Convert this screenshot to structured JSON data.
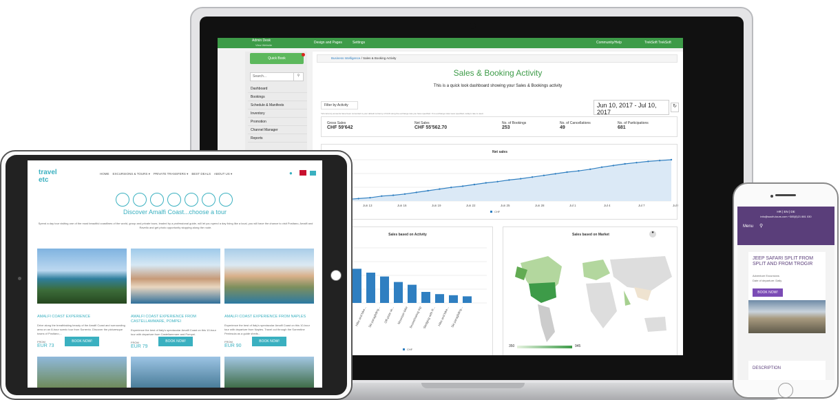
{
  "laptop": {
    "topbar": {
      "brand": "Admin Desk",
      "view_website": "View Website",
      "design": "Design and Pages",
      "settings": "Settings",
      "community": "Community/Help",
      "user": "TrekSoft TrekSoft"
    },
    "sidebar": {
      "quick_book": "Quick Book",
      "search_placeholder": "Search...",
      "items": [
        "Dashboard",
        "Bookings",
        "Schedule & Manifests",
        "Inventory",
        "Promotion",
        "Channel Manager",
        "Reports"
      ]
    },
    "breadcrumb": {
      "root": "Business Intelligence",
      "current": "Sales & Booking Activity"
    },
    "page": {
      "title": "Sales & Booking Activity",
      "subtitle": "This is a quick look dashboard showing your Sales & Bookings activity",
      "filter": "Filter by Activity",
      "note": "*All currency amounts have been converted to your default currency of CHF using the exchange rate you have specified. If no exchange rates were specified, today's rate is used.",
      "date_range": "Jun 10, 2017 - Jul 10, 2017",
      "compare_to": "Compare to"
    },
    "kpis": [
      {
        "label": "Gross Sales",
        "value": "CHF 59'642"
      },
      {
        "label": "Net Sales",
        "value": "CHF 55'562.70"
      },
      {
        "label": "No. of Bookings",
        "value": "253"
      },
      {
        "label": "No. of Cancellations",
        "value": "49"
      },
      {
        "label": "No. of Participations",
        "value": "681"
      }
    ],
    "net_sales": {
      "title": "Net sales",
      "legend": "CHF",
      "ticks": [
        "Jun 13",
        "Jun 16",
        "Jun 19",
        "Jun 22",
        "Jun 25",
        "Jun 28",
        "Jul 1",
        "Jul 4",
        "Jul 7",
        "Jul 9"
      ],
      "values": [
        2,
        4,
        6,
        8,
        12,
        14,
        17,
        21,
        25,
        29,
        33,
        36,
        40,
        44,
        47,
        51,
        54,
        58,
        62,
        66,
        70,
        73,
        77,
        82,
        86,
        90,
        93,
        96,
        98,
        100
      ]
    },
    "activity": {
      "title": "Sales based on Activity",
      "legend": "CHF",
      "labels": [
        "Sailing with R...",
        "Hike and bike...",
        "Ski paragliding...",
        "Off-piste sk...",
        "Mountain bike",
        "Snowshoeing trip",
        "Sledging with R...",
        "Hike and bike...",
        "Ski paragliding..."
      ],
      "values": [
        100,
        62,
        55,
        48,
        38,
        33,
        20,
        16,
        14,
        12
      ]
    },
    "market": {
      "title": "Sales based on Market",
      "scale_min": "350",
      "scale_max": "945"
    }
  },
  "tablet": {
    "logo": "travel etc",
    "nav": [
      "HOME",
      "EXCURSIONS & TOURS",
      "PRIVATE TRANSFERS",
      "BEST DEALS",
      "ABOUT US"
    ],
    "heading": "Discover Amalfi Coast...choose a tour",
    "intro": "Spend a day tour visiting one of the most beautiful coastlines of the world, group and private tours, leaded by a professional guide, will let you spend a day living like a local, you will have the chance to visit Positano, Amalfi and Ravello and get photo opportunity stopping along the route.",
    "tours": [
      {
        "title": "AMALFI COAST EXPERIENCE",
        "desc": "Drive along the breathtaking beauty of the Amalfi Coast and surrounding area on an 8-hour scenic tour from Sorrento. Discover the picturesque towns of Positano,...",
        "from": "FROM",
        "price": "EUR 73",
        "book": "BOOK NOW!"
      },
      {
        "title": "AMALFI COAST EXPERIENCE FROM CASTELLAMMARE, POMPEI",
        "desc": "Experience the best of Italy's spectacular Amalfi Coast on this 10-hour tour with departure from Castellammare and Pompei.",
        "from": "FROM",
        "price": "EUR 79",
        "book": "BOOK NOW!"
      },
      {
        "title": "AMALFI COAST EXPERIENCE FROM NAPLES",
        "desc": "Experience the best of Italy's spectacular Amalfi Coast on this 10-hour tour with departure from Naples. Travel out through the Sorrentine Peninsula as a guide sheds...",
        "from": "FROM",
        "price": "EUR 90",
        "book": "BOOK NOW!"
      }
    ]
  },
  "phone": {
    "langs": "HR | EN | DE",
    "contact": "info@south-tours.com  +385(0)21 881 030",
    "menu": "Menu",
    "title": "JEEP SAFARI SPLIT FROM SPLIT AND FROM TROGIR",
    "category": "Adventure Excursions",
    "departure": "Date of departure: Daily",
    "book": "BOOK NOW!",
    "description": "DESCRIPTION"
  },
  "colors": {
    "green": "#3d9b48",
    "teal": "#3ab0c0",
    "purple": "#5a3e7a",
    "chart_blue": "#2f7fc1"
  }
}
